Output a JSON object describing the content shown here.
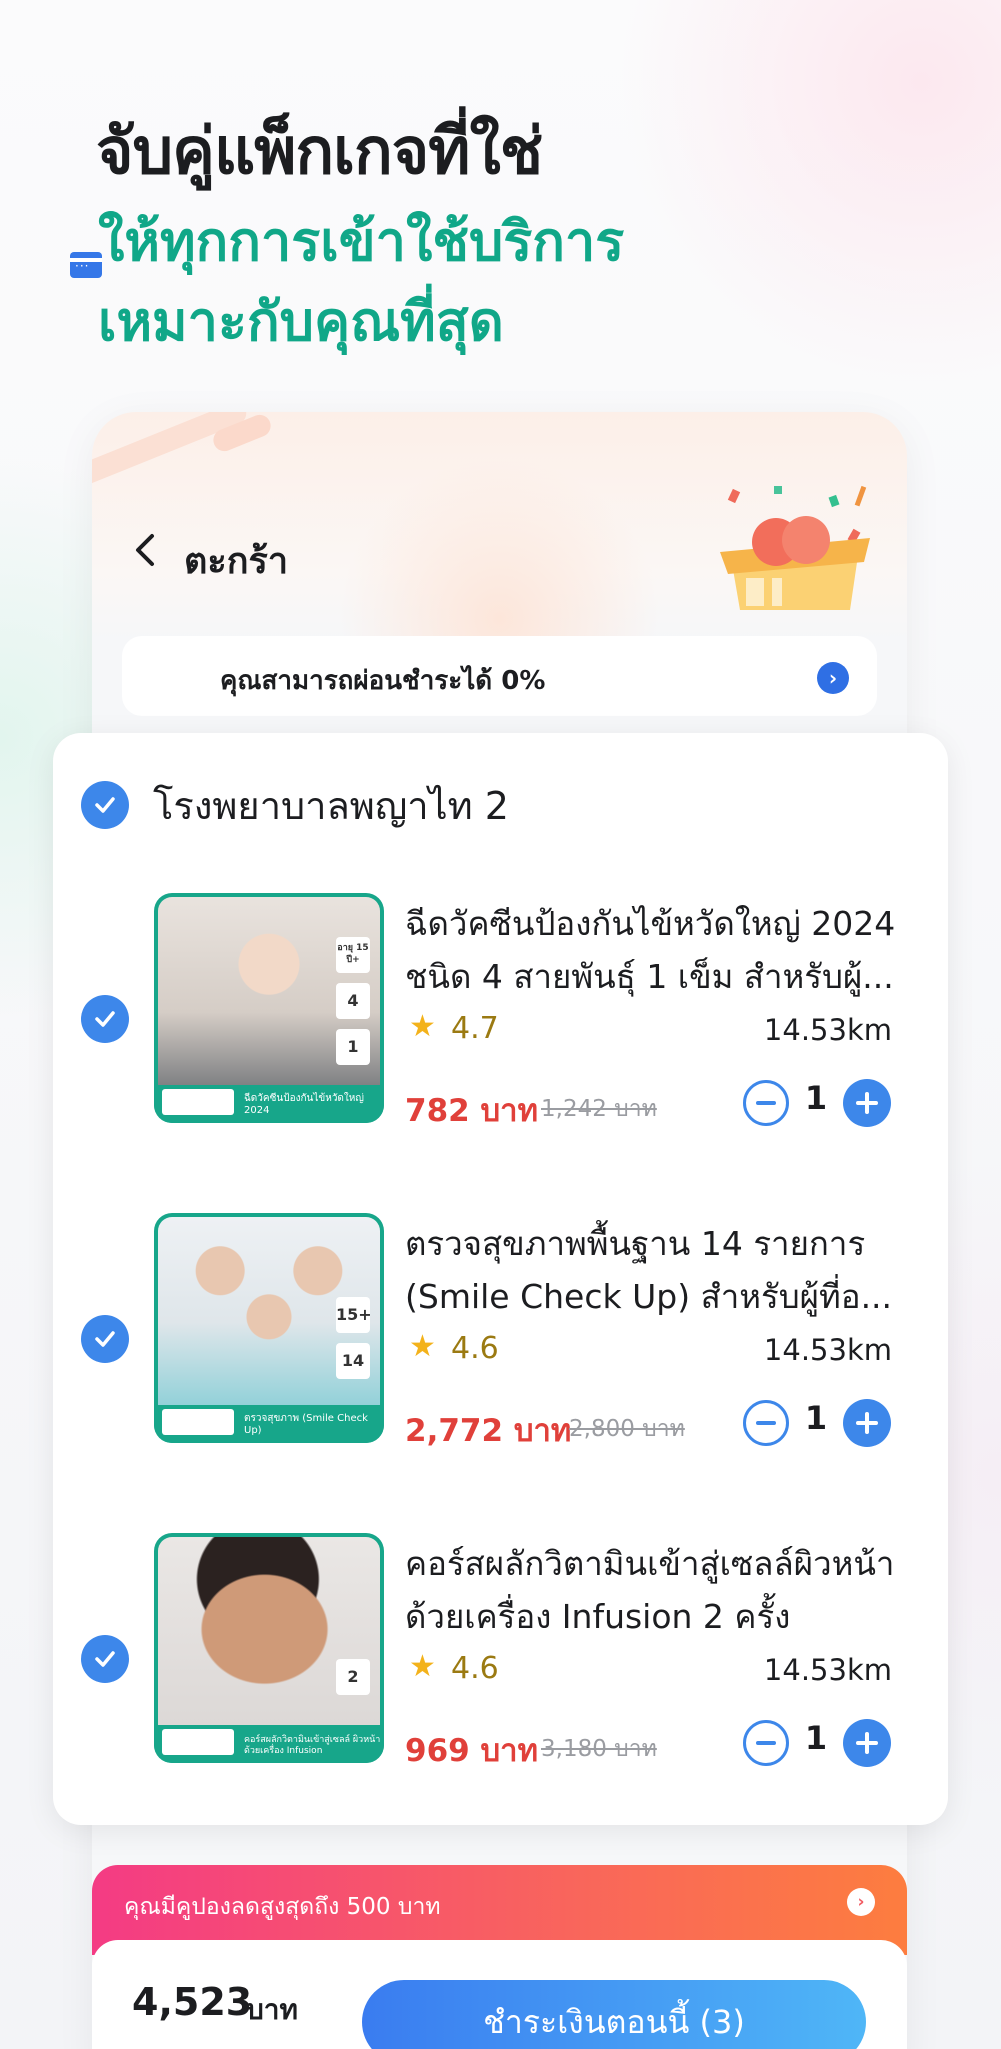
{
  "headline": "จับคู่แพ็กเกจที่ใช่",
  "subheadline_line1": "ให้ทุกการเข้าใช้บริการ",
  "subheadline_line2": "เหมาะกับคุณที่สุด",
  "cart": {
    "title": "ตะกร้า",
    "installment_text": "คุณสามารถผ่อนชำระได้ 0%"
  },
  "hospital": {
    "name": "โรงพยาบาลพญาไท 2"
  },
  "items": [
    {
      "title_line1": "ฉีดวัคซีนป้องกันไข้หวัดใหญ่ 2024",
      "title_line2": "ชนิด 4 สายพันธุ์ 1 เข็ม สำหรับผู้...",
      "rating": "4.7",
      "distance": "14.53km",
      "price": "782 บาท",
      "old_price": "1,242 บาท",
      "quantity": "1",
      "image_caption": "ฉีดวัคซีนป้องกันไข้หวัดใหญ่ 2024",
      "image_chips": [
        "อายุ 15 ปี+",
        "4",
        "1"
      ]
    },
    {
      "title_line1": "ตรวจสุขภาพพื้นฐาน 14 รายการ",
      "title_line2": "(Smile Check Up) สำหรับผู้ที่อ...",
      "rating": "4.6",
      "distance": "14.53km",
      "price": "2,772 บาท",
      "old_price": "2,800 บาท",
      "quantity": "1",
      "image_caption": "ตรวจสุขภาพ (Smile Check Up)",
      "image_chips": [
        "15+",
        "14"
      ]
    },
    {
      "title_line1": "คอร์สผลักวิตามินเข้าสู่เซลล์ผิวหน้า",
      "title_line2": "ด้วยเครื่อง Infusion 2 ครั้ง",
      "rating": "4.6",
      "distance": "14.53km",
      "price": "969 บาท",
      "old_price": "3,180 บาท",
      "quantity": "1",
      "image_caption": "คอร์สผลักวิตามินเข้าสู่เซลล์ ผิวหน้า ด้วยเครื่อง Infusion",
      "image_chips": [
        "2"
      ]
    }
  ],
  "coupon": {
    "text": "คุณมีคูปองลดสูงสุดถึง 500 บาท"
  },
  "checkout": {
    "total": "4,523",
    "total_unit": "บาท",
    "pay_button": "ชำระเงินตอนนี้ (3)"
  },
  "colors": {
    "accent_blue": "#3d87ea",
    "brand_green": "#10a788",
    "price_red": "#e0403a"
  }
}
